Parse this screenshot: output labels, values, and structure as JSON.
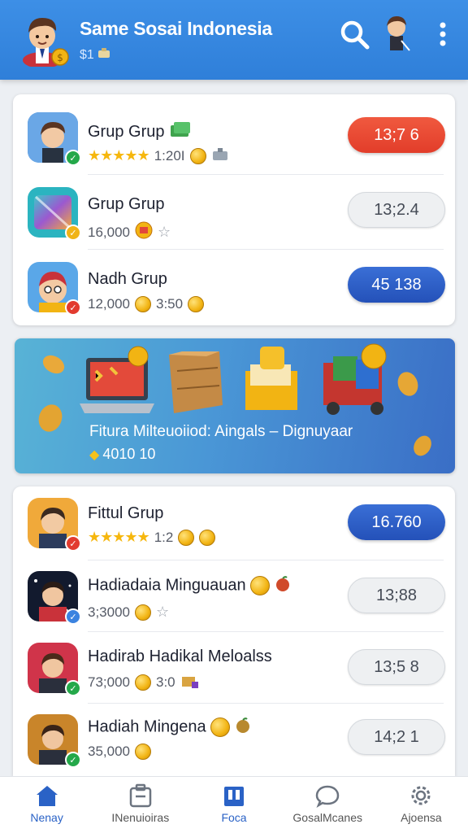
{
  "header": {
    "title": "Same Sosai Indonesia",
    "balance": "$1"
  },
  "featured_groups": [
    {
      "name": "Grup Grup",
      "rating_stars": "★★★★★",
      "count": "1:20I",
      "button": "13;7 6",
      "button_style": "red",
      "badge": "green"
    },
    {
      "name": "Grup Grup",
      "rating_stars": "",
      "count": "16,000",
      "button": "13;2.4",
      "button_style": "gray",
      "badge": "yellow"
    },
    {
      "name": "Nadh Grup",
      "rating_stars": "",
      "count": "12,000",
      "count2": "3:50",
      "button": "45 138",
      "button_style": "blue",
      "badge": "red"
    }
  ],
  "banner": {
    "text": "Fitura Milteuoiiod: Aingals – Dignuyaar",
    "reward": "4010 10"
  },
  "reward_groups": [
    {
      "name": "Fittul Grup",
      "rating_stars": "★★★★★",
      "count": "1:2",
      "button": "16.760",
      "button_style": "blue",
      "badge": "red"
    },
    {
      "name": "Hadiadaia Minguauan",
      "rating_stars": "",
      "count": "3;3000",
      "button": "13;88",
      "button_style": "gray",
      "badge": "blue"
    },
    {
      "name": "Hadirab Hadikal Meloalss",
      "rating_stars": "",
      "count": "73;000",
      "count2": "3:0",
      "button": "13;5 8",
      "button_style": "gray",
      "badge": "green"
    },
    {
      "name": "Hadiah Mingena",
      "rating_stars": "",
      "count": "35,000",
      "button": "14;2 1",
      "button_style": "gray",
      "badge": "green"
    }
  ],
  "bottom_nav": [
    {
      "label": "Nenay",
      "icon": "home-icon",
      "active": true
    },
    {
      "label": "INenuioiras",
      "icon": "inbox-icon",
      "active": false
    },
    {
      "label": "Foca",
      "icon": "book-icon",
      "active": false
    },
    {
      "label": "GosalMcanes",
      "icon": "chat-icon",
      "active": false
    },
    {
      "label": "Ajoensa",
      "icon": "gear-icon",
      "active": false
    }
  ],
  "colors": {
    "header_bg": "#3d8fe6",
    "accent_blue": "#2451b9",
    "accent_red": "#e23d2a",
    "star": "#f6b70e"
  }
}
